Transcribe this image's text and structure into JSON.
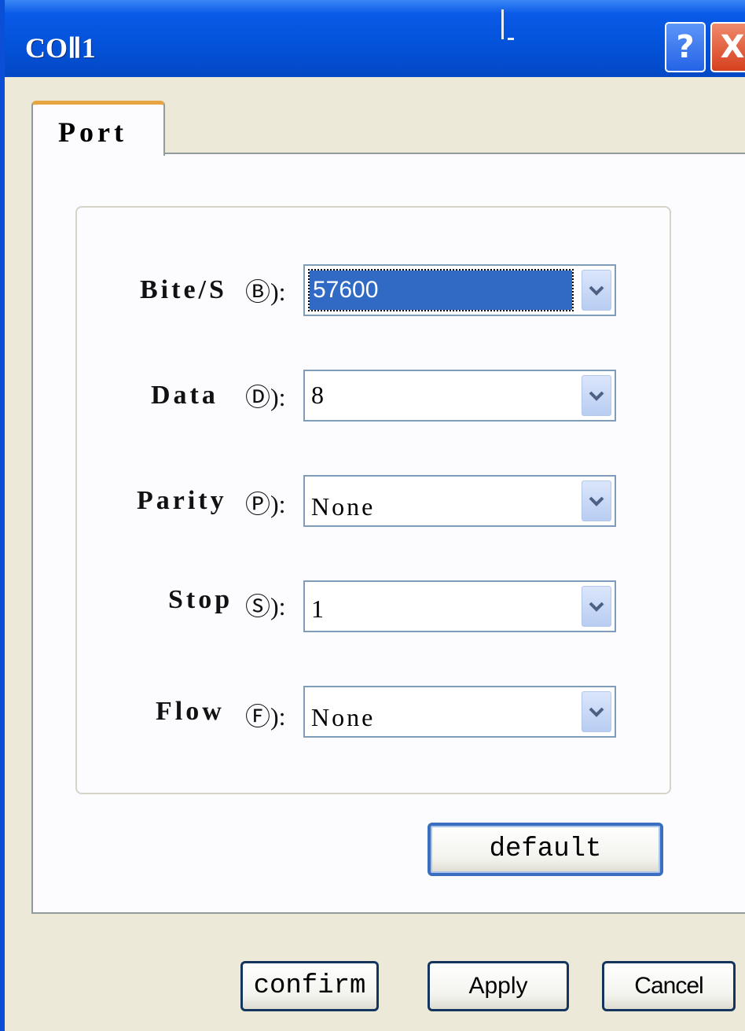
{
  "window": {
    "title": "COⅡ1",
    "help_glyph": "?",
    "close_glyph": "X"
  },
  "tabs": [
    {
      "label": "Port"
    }
  ],
  "fields": {
    "bits": {
      "label": "Bite/S",
      "key": "Ⓑ):",
      "value": "57600"
    },
    "data": {
      "label": "Data",
      "key": "Ⓓ):",
      "value": "8"
    },
    "parity": {
      "label": "Parity",
      "key": "Ⓟ):",
      "value": "None"
    },
    "stop": {
      "label": "Stop",
      "key": "Ⓢ):",
      "value": "1"
    },
    "flow": {
      "label": "Flow",
      "key": "Ⓕ):",
      "value": "None"
    }
  },
  "buttons": {
    "default_label": "default",
    "confirm_label": "confirm",
    "apply_label": "Apply",
    "cancel_label": "Cancel"
  },
  "colors": {
    "titlebar": "#0352d8",
    "selection": "#316ac5",
    "tab_accent": "#e6a540"
  },
  "icons": {
    "combo_arrow": "chevron-down-icon",
    "help": "help-icon",
    "close": "close-icon"
  }
}
